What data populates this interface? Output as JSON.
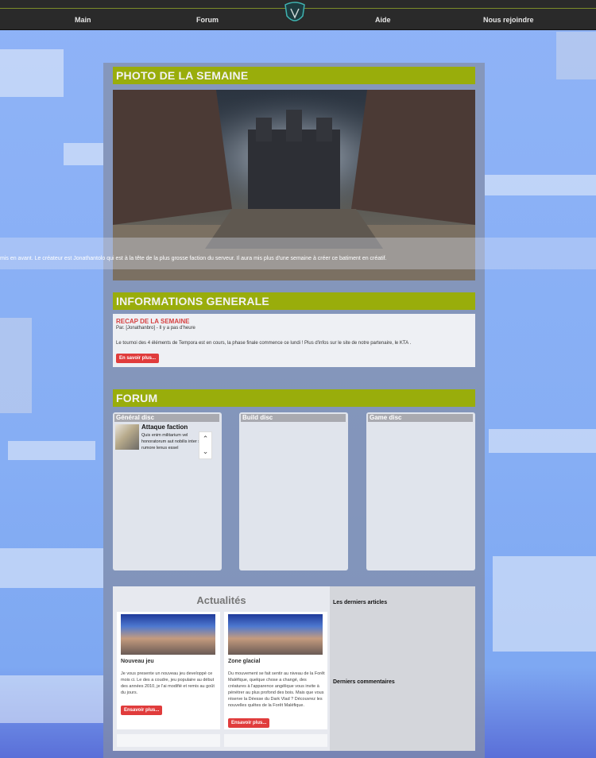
{
  "nav": {
    "items": [
      "Main",
      "Forum",
      "Aide",
      "Nous rejoindre"
    ]
  },
  "photo": {
    "heading": "PHOTO DE LA SEMAINE",
    "caption": "mis en avant. Le créateur est Jonathantolo qui est à la tête de la plus grosse faction du serveur. Il aura mis plus d'une semaine à créer ce batiment en créatif."
  },
  "info": {
    "heading": "INFORMATIONS GENERALE",
    "post_title": "RECAP DE LA SEMAINE",
    "meta": "Par. [Jonathanbro] - Il y a pas d'heure",
    "body": "Le tournoi des 4 éléments de Tempora est en cours, la phase finale commence ce lundi ! Plus d'infos sur le site de notre partenaire, le KTA .",
    "button": "En savoir plus..."
  },
  "forum": {
    "heading": "FORUM",
    "columns": [
      "Général disc",
      "Build disc",
      "Game disc"
    ],
    "thread": {
      "title": "Attaque faction",
      "text": "Quis enim militarium vel honoratorum aut nobilis inter suos rumore lenus essel"
    },
    "scroll_up": "⌃",
    "scroll_down": "⌄"
  },
  "news": {
    "title": "Actualités",
    "cards": [
      {
        "title": "Nouveau jeu",
        "text": "Je vous presente un nouveau jeu developpé ce mois ci.\nLe des a coudre, jeu populaire au début des années 2010, je l'ai modifié et remis au goût du jours.",
        "button": "Ensavoir plus..."
      },
      {
        "title": "Zone glacial",
        "text": "Du mouvement se fait sentir au niveau de la Forêt Maléfique, quelque chose a changé, des créatures à l'apparence angélique vous invite à pénétrer au plus profond des bois. Mais que vous réserve la Déesse du Dark Vlad ? Découvrez les nouvelles quêtes de la Forêt Maléfique.",
        "button": "Ensavoir plus..."
      }
    ],
    "sidebar": {
      "latest_articles": "Les derniers articles",
      "latest_comments": "Derniers commentaires"
    }
  },
  "colors": {
    "accent": "#99ad0b",
    "button": "#e03c3c",
    "nav_bg": "#2a2a2a"
  }
}
